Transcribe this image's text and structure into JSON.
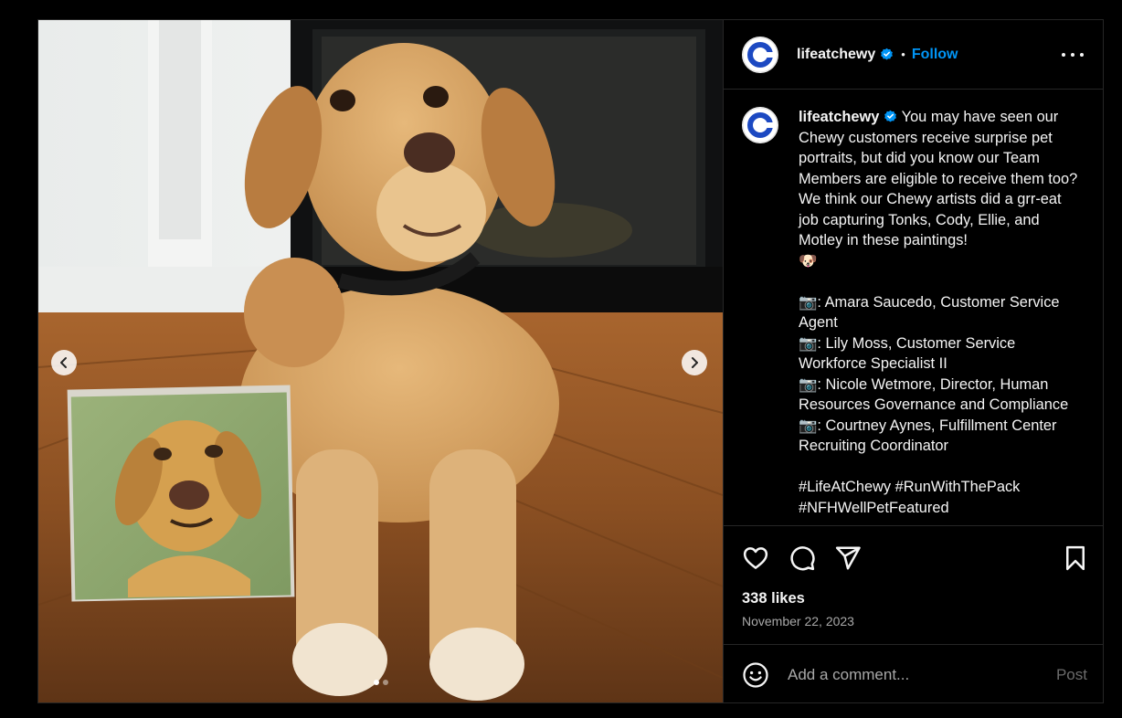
{
  "post": {
    "username": "lifeatchewy",
    "separator": "•",
    "follow_label": "Follow",
    "avatar_letter": "C",
    "caption": "You may have seen our Chewy customers receive surprise pet portraits, but did you know our Team Members are eligible to receive them too? We think our Chewy artists did a grr-eat job capturing Tonks, Cody, Ellie, and Motley in these paintings!\n🐶\n\n📷: Amara Saucedo, Customer Service Agent\n📷: Lily Moss, Customer Service Workforce Specialist II\n📷: Nicole Wetmore, Director, Human Resources Governance and Compliance\n📷: Courtney Aynes, Fulfillment Center Recruiting Coordinator\n\n#LifeAtChewy #RunWithThePack\n#NFHWellPetFeatured",
    "likes": "338 likes",
    "date": "November 22, 2023"
  },
  "comment": {
    "placeholder": "Add a comment...",
    "post_label": "Post"
  },
  "carousel": {
    "slide_count": 2,
    "active_index": 0
  },
  "icons": {
    "more": "more-options-icon",
    "verified": "verified-badge-icon",
    "like": "heart-icon",
    "comment": "comment-bubble-icon",
    "share": "paper-plane-icon",
    "save": "bookmark-icon",
    "emoji": "smiley-icon",
    "prev": "chevron-left-icon",
    "next": "chevron-right-icon"
  },
  "colors": {
    "background": "#000000",
    "accent": "#0095f6",
    "verified": "#0095f6",
    "muted_text": "#a8a8a8",
    "brand": "#1c49c2"
  }
}
